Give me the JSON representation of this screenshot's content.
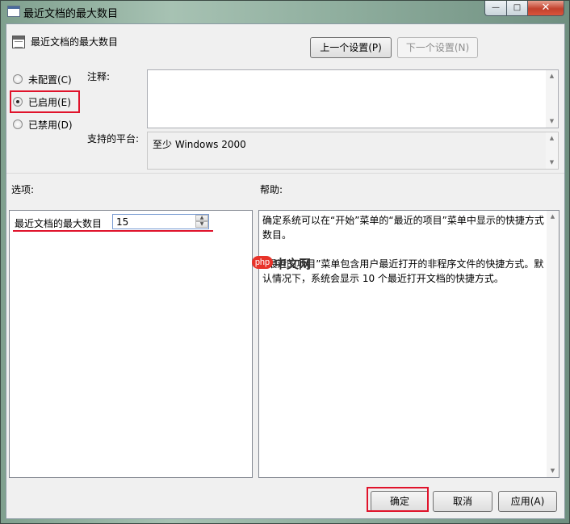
{
  "window": {
    "title": "最近文档的最大数目",
    "minimize_glyph": "—",
    "maximize_glyph": "□",
    "close_glyph": "✕"
  },
  "header": {
    "setting_title": "最近文档的最大数目",
    "prev_button": "上一个设置(P)",
    "next_button": "下一个设置(N)"
  },
  "state": {
    "options": [
      {
        "label": "未配置(C)",
        "checked": false
      },
      {
        "label": "已启用(E)",
        "checked": true
      },
      {
        "label": "已禁用(D)",
        "checked": false
      }
    ]
  },
  "comment": {
    "label": "注释:",
    "value": ""
  },
  "platform": {
    "label": "支持的平台:",
    "value": "至少 Windows 2000"
  },
  "options_section": {
    "label": "选项:",
    "max_docs_label": "最近文档的最大数目",
    "max_docs_value": "15"
  },
  "help_section": {
    "label": "帮助:",
    "paragraph1": "确定系统可以在“开始”菜单的“最近的项目”菜单中显示的快捷方式数目。",
    "paragraph2": "“最近的项目”菜单包含用户最近打开的非程序文件的快捷方式。默认情况下，系统会显示 10 个最近打开文档的快捷方式。"
  },
  "watermark": {
    "badge": "php",
    "text": "中文网"
  },
  "footer": {
    "ok_button": "确定",
    "cancel_button": "取消",
    "apply_button": "应用(A)"
  },
  "colors": {
    "highlight_red": "#e0132b",
    "dialog_bg": "#f0f0f0"
  }
}
